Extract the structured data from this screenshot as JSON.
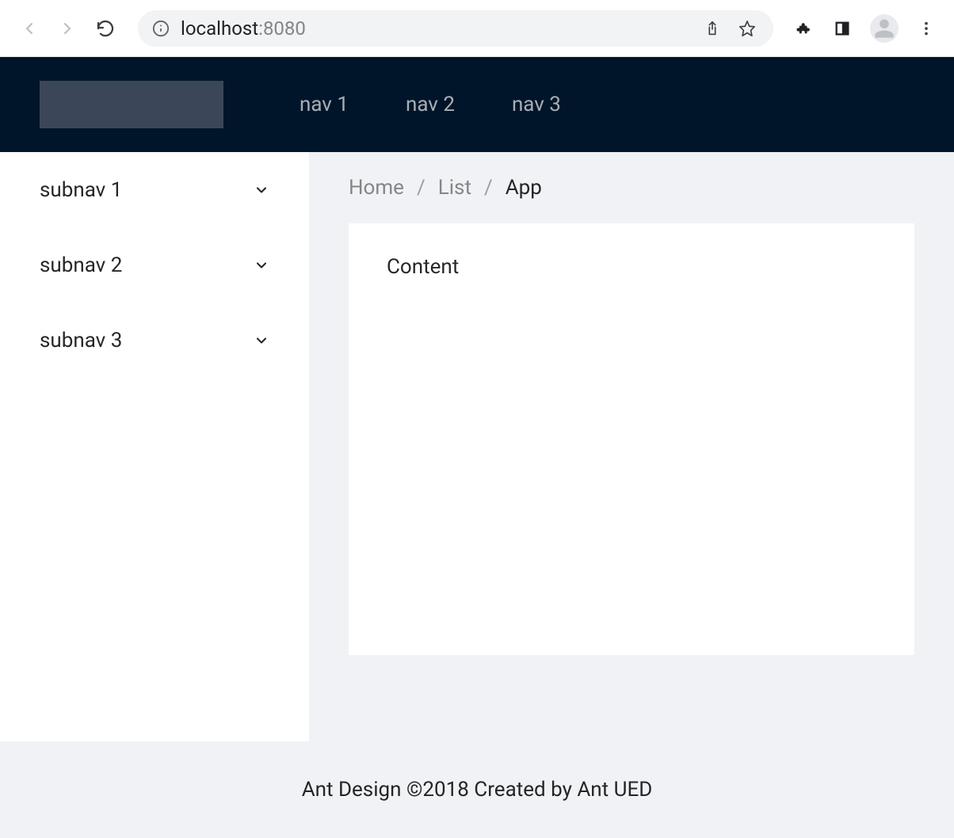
{
  "browser": {
    "url_host": "localhost",
    "url_port": ":8080"
  },
  "header": {
    "nav": [
      {
        "label": "nav 1"
      },
      {
        "label": "nav 2"
      },
      {
        "label": "nav 3"
      }
    ]
  },
  "sidebar": {
    "items": [
      {
        "label": "subnav 1"
      },
      {
        "label": "subnav 2"
      },
      {
        "label": "subnav 3"
      }
    ]
  },
  "breadcrumb": {
    "items": [
      {
        "label": "Home"
      },
      {
        "label": "List"
      },
      {
        "label": "App"
      }
    ],
    "separator": "/"
  },
  "main": {
    "content": "Content"
  },
  "footer": {
    "text": "Ant Design ©2018 Created by Ant UED"
  }
}
